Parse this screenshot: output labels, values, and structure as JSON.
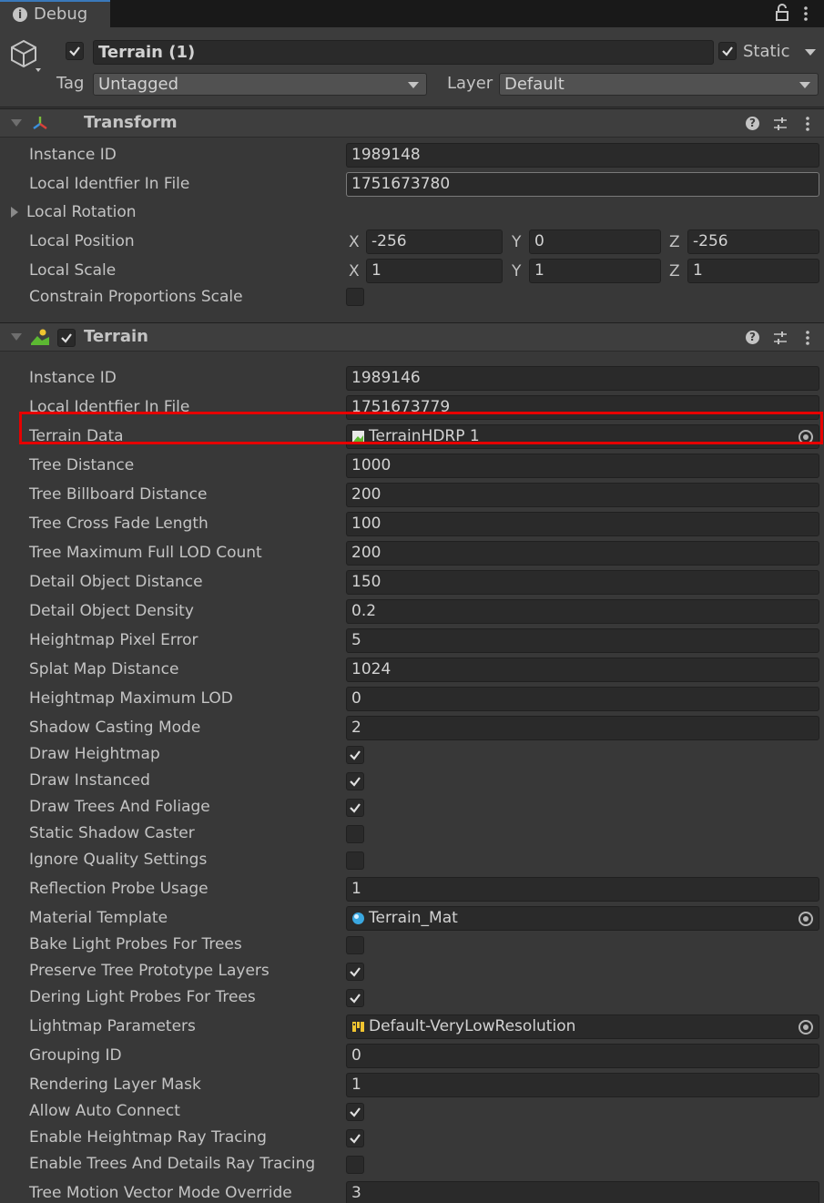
{
  "tab": {
    "label": "Debug"
  },
  "header": {
    "name": "Terrain (1)",
    "static_label": "Static",
    "tag_label": "Tag",
    "tag_value": "Untagged",
    "layer_label": "Layer",
    "layer_value": "Default"
  },
  "transform": {
    "title": "Transform",
    "instance_id_label": "Instance ID",
    "instance_id": "1989148",
    "local_identifier_label": "Local Identfier In File",
    "local_identifier": "1751673780",
    "local_rotation_label": "Local Rotation",
    "local_position_label": "Local Position",
    "local_position": {
      "x": "-256",
      "y": "0",
      "z": "-256"
    },
    "local_scale_label": "Local Scale",
    "local_scale": {
      "x": "1",
      "y": "1",
      "z": "1"
    },
    "constrain_label": "Constrain Proportions Scale",
    "axis_x": "X",
    "axis_y": "Y",
    "axis_z": "Z"
  },
  "terrain": {
    "title": "Terrain",
    "rows": [
      {
        "label": "Instance ID",
        "type": "field",
        "value": "1989146"
      },
      {
        "label": "Local Identfier In File",
        "type": "field",
        "value": "1751673779"
      },
      {
        "label": "Terrain Data",
        "type": "object",
        "value": "TerrainHDRP 1",
        "icon": "terrain-data-icon"
      },
      {
        "label": "Tree Distance",
        "type": "field",
        "value": "1000"
      },
      {
        "label": "Tree Billboard Distance",
        "type": "field",
        "value": "200"
      },
      {
        "label": "Tree Cross Fade Length",
        "type": "field",
        "value": "100"
      },
      {
        "label": "Tree Maximum Full LOD Count",
        "type": "field",
        "value": "200"
      },
      {
        "label": "Detail Object Distance",
        "type": "field",
        "value": "150"
      },
      {
        "label": "Detail Object Density",
        "type": "field",
        "value": "0.2"
      },
      {
        "label": "Heightmap Pixel Error",
        "type": "field",
        "value": "5"
      },
      {
        "label": "Splat Map Distance",
        "type": "field",
        "value": "1024"
      },
      {
        "label": "Heightmap Maximum LOD",
        "type": "field",
        "value": "0"
      },
      {
        "label": "Shadow Casting Mode",
        "type": "field",
        "value": "2"
      },
      {
        "label": "Draw Heightmap",
        "type": "check",
        "checked": true
      },
      {
        "label": "Draw Instanced",
        "type": "check",
        "checked": true
      },
      {
        "label": "Draw Trees And Foliage",
        "type": "check",
        "checked": true
      },
      {
        "label": "Static Shadow Caster",
        "type": "check",
        "checked": false
      },
      {
        "label": "Ignore Quality Settings",
        "type": "check",
        "checked": false
      },
      {
        "label": "Reflection Probe Usage",
        "type": "field",
        "value": "1"
      },
      {
        "label": "Material Template",
        "type": "object",
        "value": "Terrain_Mat",
        "icon": "material-icon"
      },
      {
        "label": "Bake Light Probes For Trees",
        "type": "check",
        "checked": false
      },
      {
        "label": "Preserve Tree Prototype Layers",
        "type": "check",
        "checked": true
      },
      {
        "label": "Dering Light Probes For Trees",
        "type": "check",
        "checked": true
      },
      {
        "label": "Lightmap Parameters",
        "type": "object",
        "value": "Default-VeryLowResolution",
        "icon": "lightmap-parameters-icon"
      },
      {
        "label": "Grouping ID",
        "type": "field",
        "value": "0"
      },
      {
        "label": "Rendering Layer Mask",
        "type": "field",
        "value": "1"
      },
      {
        "label": "Allow Auto Connect",
        "type": "check",
        "checked": true
      },
      {
        "label": "Enable Heightmap Ray Tracing",
        "type": "check",
        "checked": true
      },
      {
        "label": "Enable Trees And Details Ray Tracing",
        "type": "check",
        "checked": false
      },
      {
        "label": "Tree Motion Vector Mode Override",
        "type": "field",
        "value": "3"
      }
    ]
  },
  "colors": {
    "highlight": "#e60000",
    "tab_accent": "#3a79bb"
  }
}
